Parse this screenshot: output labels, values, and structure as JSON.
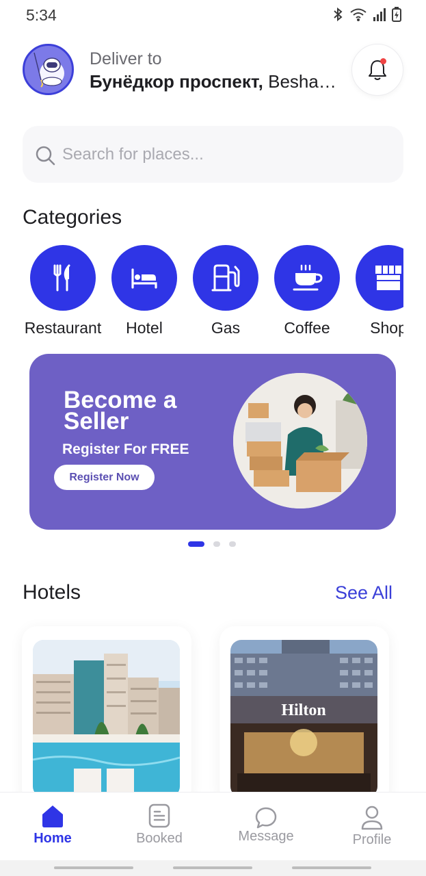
{
  "status_bar": {
    "time": "5:34"
  },
  "header": {
    "deliver_label": "Deliver to",
    "address_bold": "Бунёдкор проспект,",
    "address_rest": " Beshagach..."
  },
  "search": {
    "placeholder": "Search for places..."
  },
  "categories": {
    "title": "Categories",
    "items": [
      {
        "label": "Restaurant",
        "icon": "utensils-icon"
      },
      {
        "label": "Hotel",
        "icon": "bed-icon"
      },
      {
        "label": "Gas",
        "icon": "gas-pump-icon"
      },
      {
        "label": "Coffee",
        "icon": "coffee-cup-icon"
      },
      {
        "label": "Shop",
        "icon": "store-icon"
      }
    ]
  },
  "banner": {
    "title": "Become a Seller",
    "subtitle": "Register For FREE",
    "button": "Register Now",
    "active_dot": 0,
    "dot_count": 3
  },
  "hotels": {
    "title": "Hotels",
    "see_all": "See All",
    "items": [
      {
        "image": "resort-pool-photo"
      },
      {
        "image": "hilton-facade-photo",
        "sign": "Hilton"
      }
    ]
  },
  "bottom_nav": {
    "items": [
      {
        "label": "Home",
        "active": true
      },
      {
        "label": "Booked",
        "active": false
      },
      {
        "label": "Message",
        "active": false
      },
      {
        "label": "Profile",
        "active": false
      }
    ]
  },
  "colors": {
    "accent": "#2f35e6",
    "banner": "#6e60c5",
    "notification": "#ef4444"
  }
}
